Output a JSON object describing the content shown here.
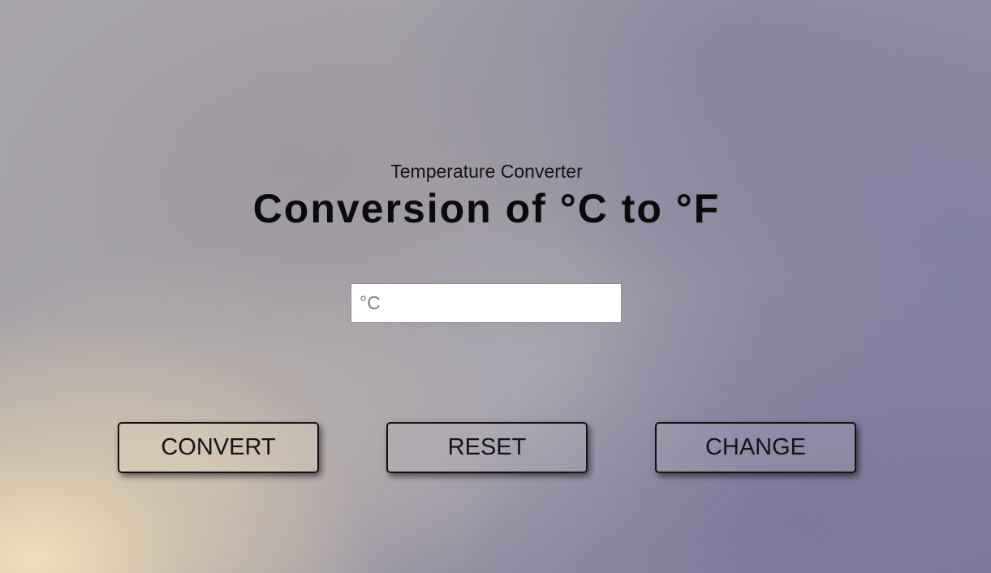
{
  "header": {
    "subtitle": "Temperature Converter",
    "title": "Conversion of °C to °F"
  },
  "input": {
    "value": "",
    "placeholder": "°C"
  },
  "buttons": {
    "convert_label": "CONVERT",
    "reset_label": "RESET",
    "change_label": "CHANGE"
  }
}
